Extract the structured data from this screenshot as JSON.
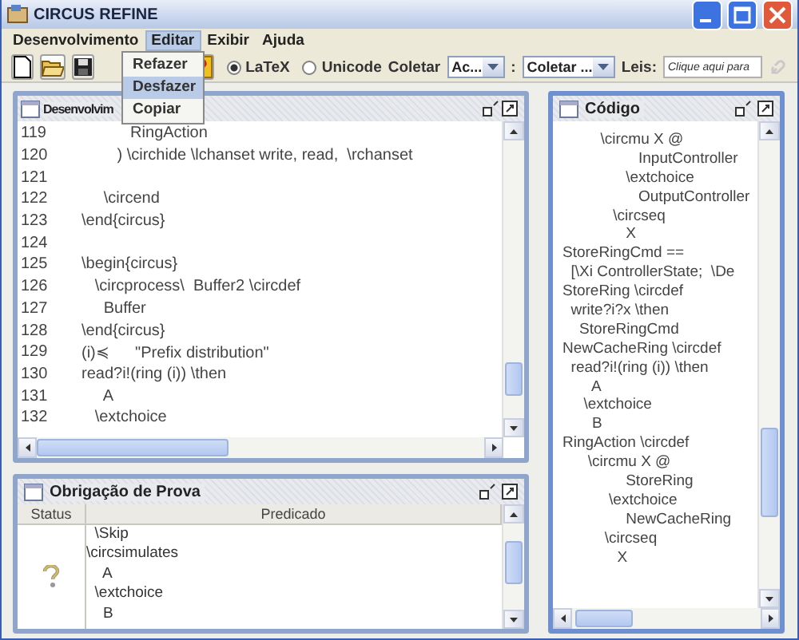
{
  "window": {
    "title": "CIRCUS REFINE"
  },
  "menu": [
    {
      "label": "Desenvolvimento",
      "selected": false
    },
    {
      "label": "Editar",
      "selected": true
    },
    {
      "label": "Exibir",
      "selected": false
    },
    {
      "label": "Ajuda",
      "selected": false
    }
  ],
  "open_menu": {
    "items": [
      {
        "label": "Refazer",
        "selected": false
      },
      {
        "label": "Desfazer",
        "selected": true
      },
      {
        "label": "Copiar",
        "selected": false
      }
    ]
  },
  "toolbar": {
    "notation": [
      {
        "label": "LaTeX",
        "selected": true
      },
      {
        "label": "Unicode",
        "selected": false
      }
    ],
    "collect_label": "Coletar",
    "combo_1": "Ac...",
    "separator": ":",
    "combo_2": "Coletar ...",
    "laws_label": "Leis:",
    "laws_field": {
      "placeholder": "Clique aqui para"
    }
  },
  "development_panel": {
    "title": "Desenvolvim",
    "lines": [
      {
        "number": "119",
        "text": "           RingAction"
      },
      {
        "number": "120",
        "text": "        ) \\circhide \\lchanset write, read,  \\rchanset"
      },
      {
        "number": "121"
      },
      {
        "number": "122",
        "text": "     \\circend"
      },
      {
        "number": "123",
        "text": "\\end{circus}"
      },
      {
        "number": "124"
      },
      {
        "number": "125",
        "text": "\\begin{circus}"
      },
      {
        "number": "126",
        "text": "   \\circprocess\\  Buffer2 \\circdef"
      },
      {
        "number": "127",
        "text": "     Buffer"
      },
      {
        "number": "128",
        "text": "\\end{circus}"
      },
      {
        "number": "129",
        "text": "(i)≼      \"Prefix distribution\""
      },
      {
        "number": "130",
        "text": "read?i!(ring (i)) \\then"
      },
      {
        "number": "131",
        "text": "     A"
      },
      {
        "number": "132",
        "text": "   \\extchoice"
      }
    ]
  },
  "proof_panel": {
    "title": "Obrigação de Prova",
    "columns": [
      "Status",
      "Predicado"
    ],
    "rows": [
      {
        "kind": "unknown",
        "predicate": [
          "  \\Skip",
          "\\circsimulates",
          "    A",
          "  \\extchoice",
          "    B"
        ]
      }
    ]
  },
  "code_panel": {
    "title": "Código",
    "lines": [
      "         \\circmu X @",
      "                  InputController",
      "               \\extchoice",
      "                  OutputController",
      "            \\circseq",
      "               X",
      "StoreRingCmd ==",
      "  [\\Xi ControllerState;  \\De",
      "StoreRing \\circdef",
      "  write?i?x \\then",
      "    StoreRingCmd",
      "NewCacheRing \\circdef",
      "  read?i!(ring (i)) \\then",
      "       A",
      "     \\extchoice",
      "       B",
      "RingAction \\circdef",
      "      \\circmu X @",
      "               StoreRing",
      "           \\extchoice",
      "               NewCacheRing",
      "          \\circseq",
      "             X"
    ]
  }
}
